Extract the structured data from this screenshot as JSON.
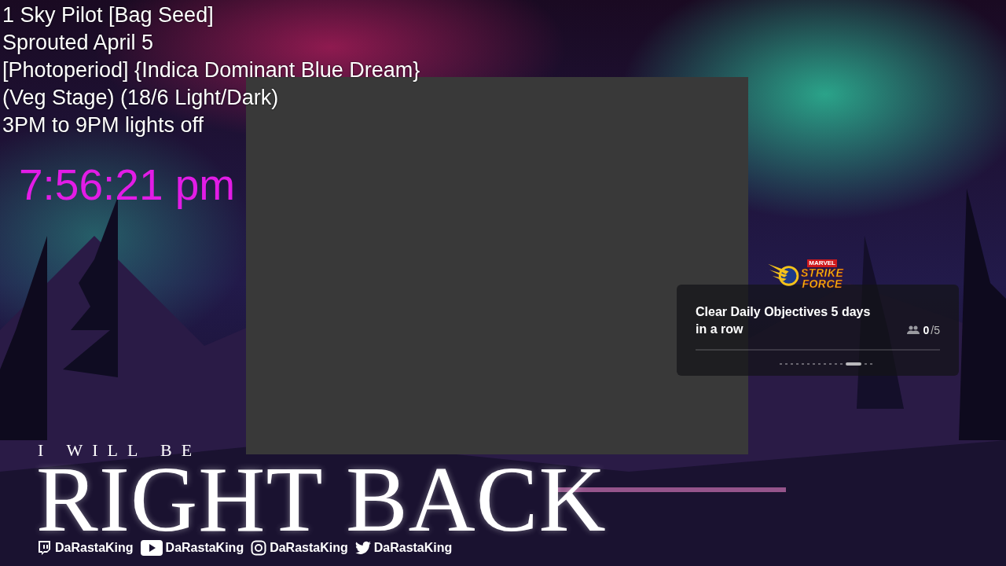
{
  "info_lines": [
    "1 Sky Pilot [Bag Seed]",
    "Sprouted April 5",
    "[Photoperiod] {Indica Dominant Blue Dream}",
    "(Veg Stage) (18/6 Light/Dark)",
    "3PM to 9PM lights off"
  ],
  "clock": "7:56:21 pm",
  "goal_widget": {
    "logo_top": "MARVEL",
    "logo_lines": [
      "STRIKE",
      "FORCE"
    ],
    "title": "Clear Daily Objectives 5 days in a row",
    "count_done": "0",
    "count_total": "/5",
    "level": 0,
    "dots": [
      {
        "selected": false
      },
      {
        "selected": false
      },
      {
        "selected": false
      },
      {
        "selected": false
      },
      {
        "selected": false
      },
      {
        "selected": false
      },
      {
        "selected": false
      },
      {
        "selected": false
      },
      {
        "selected": false
      },
      {
        "selected": false
      },
      {
        "selected": false
      },
      {
        "selected": false
      },
      {
        "selected": true
      },
      {
        "selected": false
      },
      {
        "selected": false
      }
    ]
  },
  "brb": {
    "kicker": "I WILL BE",
    "headline": "RIGHT BACK"
  },
  "socials": [
    {
      "kind": "twitch",
      "handle": "DaRastaKing"
    },
    {
      "kind": "youtube",
      "handle": "DaRastaKing"
    },
    {
      "kind": "instagram",
      "handle": "DaRastaKing"
    },
    {
      "kind": "twitter",
      "handle": "DaRastaKing"
    }
  ]
}
